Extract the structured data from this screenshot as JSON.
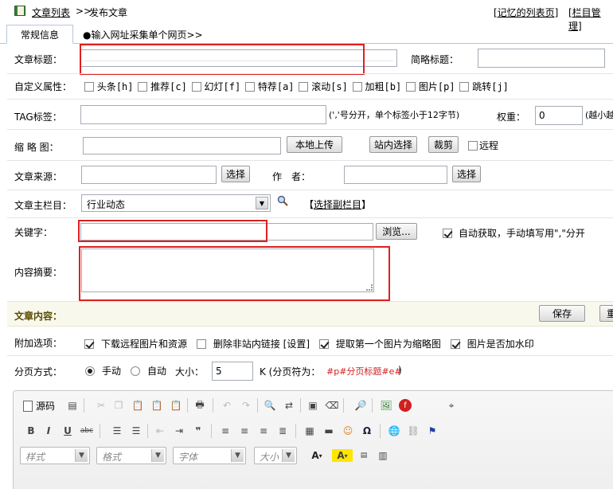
{
  "header": {
    "article_list": "文章列表",
    "sep": ">>",
    "publish": "发布文章",
    "remember_list": "[记忆的列表页]",
    "column_manage": "[栏目管理]"
  },
  "tabs": [
    {
      "label": "常规信息"
    },
    {
      "label": "●输入网址采集单个网页>>"
    }
  ],
  "form": {
    "title_label": "文章标题：",
    "short_title_label": "简略标题：",
    "custom_attr_label": "自定义属性：",
    "attrs": [
      "头条[h]",
      "推荐[c]",
      "幻灯[f]",
      "特荐[a]",
      "滚动[s]",
      "加粗[b]",
      "图片[p]",
      "跳转[j]"
    ],
    "tag_label": "TAG标签：",
    "tag_hint": "(','号分开，单个标签小于12字节)",
    "weight_label": "权重：",
    "weight_value": "0",
    "weight_hint": "(越小越",
    "thumb_label": "缩 略 图：",
    "local_upload": "本地上传",
    "site_select": "站内选择",
    "crop": "裁剪",
    "remote": "远程",
    "source_label": "文章来源：",
    "select": "选择",
    "author_label": "作　者：",
    "main_column_label": "文章主栏目：",
    "main_column_value": "行业动态",
    "select_sub_column": "选择副栏目",
    "keywords_label": "关键字：",
    "browse": "浏览...",
    "auto_get": "自动获取，手动填写用\",\"分开",
    "summary_label": "内容摘要：",
    "content_label": "文章内容：",
    "save": "保存",
    "reset_partial": "重",
    "extra_label": "附加选项：",
    "extras": [
      "下载远程图片和资源",
      "删除非站内链接 [设置]",
      "提取第一个图片为缩略图",
      "图片是否加水印"
    ],
    "paging_label": "分页方式：",
    "manual": "手动",
    "auto": "自动",
    "size_label": "大小：",
    "size_value": "5",
    "size_unit": "K (分页符为：",
    "page_marker": "#p#分页标题#e#",
    "size_close": ")"
  },
  "editor": {
    "source": "源码",
    "style": "样式",
    "format": "格式",
    "font": "字体",
    "size": "大小"
  }
}
